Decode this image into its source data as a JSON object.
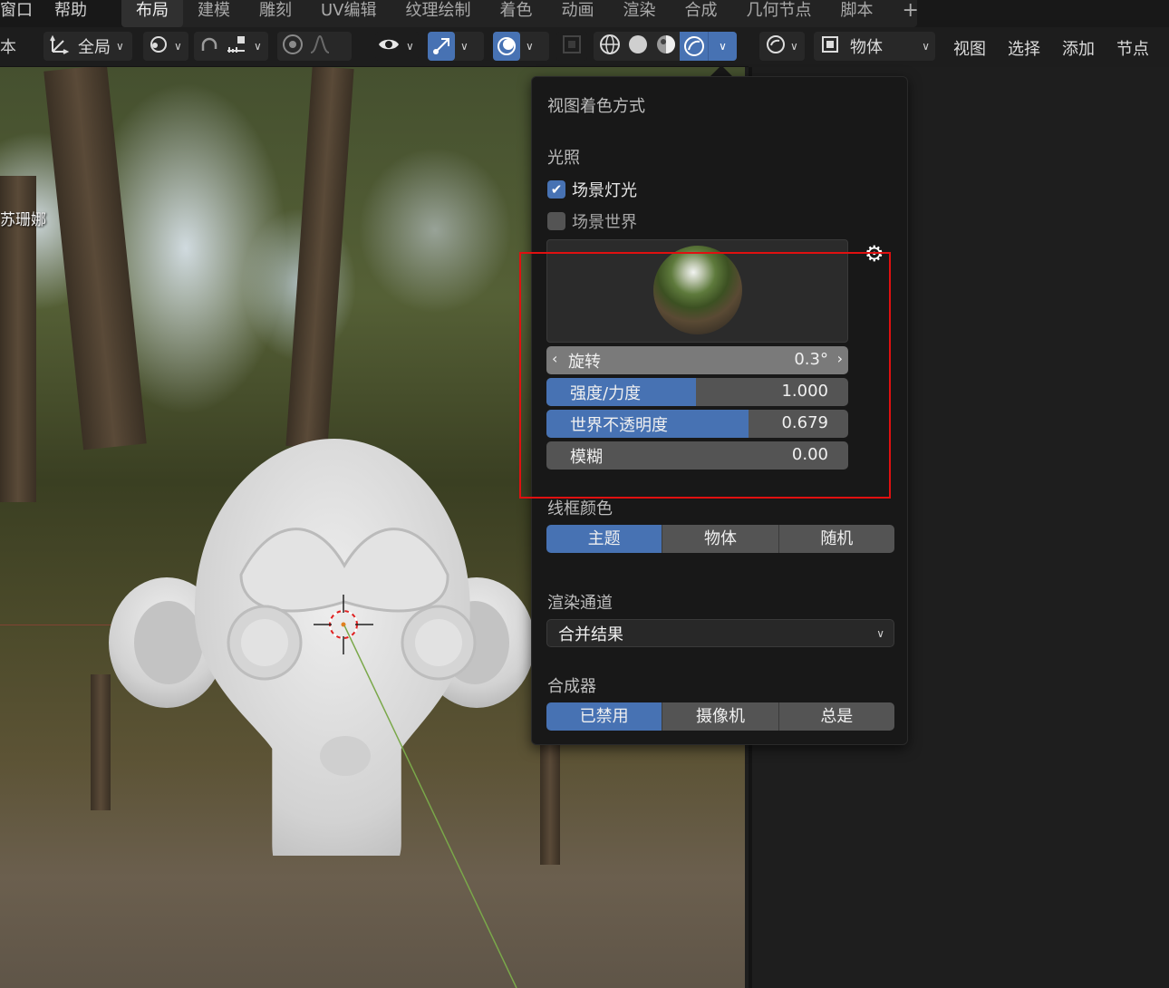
{
  "menubar": {
    "window": "窗口",
    "help": "帮助"
  },
  "workspace_tabs": [
    "布局",
    "建模",
    "雕刻",
    "UV编辑",
    "纹理绘制",
    "着色",
    "动画",
    "渲染",
    "合成",
    "几何节点",
    "脚本"
  ],
  "workspace_add": "+",
  "header": {
    "left_edge": "本",
    "transform_orientation": "全局",
    "right_view_mode": "物体",
    "right_menus": [
      "视图",
      "选择",
      "添加",
      "节点"
    ]
  },
  "viewport": {
    "object_label": "苏珊娜"
  },
  "shading_popover": {
    "title": "视图着色方式",
    "lighting_section": "光照",
    "scene_lights": {
      "label": "场景灯光",
      "checked": true
    },
    "scene_world": {
      "label": "场景世界",
      "checked": false
    },
    "rotation": {
      "label": "旋转",
      "value": "0.3°"
    },
    "strength": {
      "label": "强度/力度",
      "value": "1.000",
      "fill_fraction": 0.495
    },
    "world_opacity": {
      "label": "世界不透明度",
      "value": "0.679",
      "fill_fraction": 0.67
    },
    "blur": {
      "label": "模糊",
      "value": "0.00"
    },
    "wireframe_color_section": "线框颜色",
    "wireframe_options": [
      "主题",
      "物体",
      "随机"
    ],
    "wireframe_active": "主题",
    "render_pass_section": "渲染通道",
    "render_pass_value": "合并结果",
    "compositor_section": "合成器",
    "compositor_options": [
      "已禁用",
      "摄像机",
      "总是"
    ],
    "compositor_active": "已禁用"
  },
  "colors": {
    "accent": "#4772b3",
    "highlight_box": "#e01010",
    "panel_bg": "#181818"
  }
}
